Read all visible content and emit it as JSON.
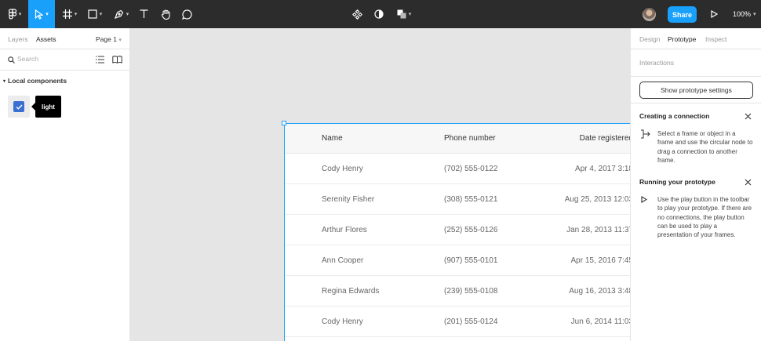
{
  "toolbar": {
    "share_label": "Share",
    "zoom": "100%",
    "caret": "▾",
    "tools": [
      "main-menu",
      "move",
      "frame",
      "shape",
      "pen",
      "text",
      "hand",
      "comment"
    ],
    "center_tools": [
      "component",
      "mask",
      "boolean"
    ]
  },
  "left_panel": {
    "tabs": [
      "Layers",
      "Assets"
    ],
    "active_tab": "Assets",
    "page_label": "Page 1",
    "search_placeholder": "Search",
    "section_title": "Local components",
    "component_tooltip": "light"
  },
  "table": {
    "headers": {
      "name": "Name",
      "phone": "Phone number",
      "date": "Date registered"
    },
    "rows": [
      {
        "name": "Cody Henry",
        "phone": "(702) 555-0122",
        "date": "Apr 4, 2017 3:18"
      },
      {
        "name": "Serenity Fisher",
        "phone": "(308) 555-0121",
        "date": "Aug 25, 2013 12:03"
      },
      {
        "name": "Arthur Flores",
        "phone": "(252) 555-0126",
        "date": "Jan 28, 2013 11:37"
      },
      {
        "name": "Ann Cooper",
        "phone": "(907) 555-0101",
        "date": "Apr 15, 2016 7:45"
      },
      {
        "name": "Regina Edwards",
        "phone": "(239) 555-0108",
        "date": "Aug 16, 2013 3:48"
      },
      {
        "name": "Cody Henry",
        "phone": "(201) 555-0124",
        "date": "Jun 6, 2014 11:03"
      }
    ]
  },
  "right_panel": {
    "tabs": [
      "Design",
      "Prototype",
      "Inspect"
    ],
    "active_tab": "Prototype",
    "interactions_label": "Interactions",
    "show_settings_label": "Show prototype settings",
    "sections": [
      {
        "title": "Creating a connection",
        "text": "Select a frame or object in a frame and use the circular node to drag a connection to another frame."
      },
      {
        "title": "Running your prototype",
        "text": "Use the play button in the toolbar to play your prototype. If there are no connections, the play button can be used to play a presentation of your frames."
      }
    ]
  },
  "colors": {
    "toolbar_bg": "#2c2c2c",
    "accent": "#18a0fb",
    "canvas_bg": "#e5e5e5",
    "component_blue": "#3b6fd1"
  }
}
